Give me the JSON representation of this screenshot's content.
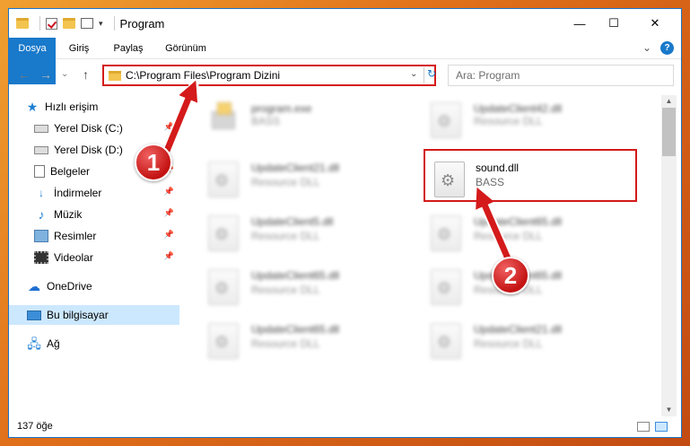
{
  "window": {
    "title": "Program",
    "minimize_glyph": "—",
    "maximize_glyph": "☐",
    "close_glyph": "✕"
  },
  "ribbon": {
    "tabs": [
      {
        "label": "Dosya"
      },
      {
        "label": "Giriş"
      },
      {
        "label": "Paylaş"
      },
      {
        "label": "Görünüm"
      }
    ],
    "collapse_glyph": "⌄",
    "help_glyph": "?"
  },
  "navbar": {
    "back_glyph": "←",
    "forward_glyph": "→",
    "history_glyph": "⌄",
    "up_glyph": "↑",
    "address": "C:\\Program Files\\Program Dizini",
    "dropdown_glyph": "⌄",
    "refresh_glyph": "↻",
    "search_placeholder": "Ara: Program"
  },
  "sidebar": {
    "items": [
      {
        "label": "Hızlı erişim",
        "icon": "star-icon",
        "pinned": false
      },
      {
        "label": "Yerel Disk (C:)",
        "icon": "drive-icon",
        "pinned": true
      },
      {
        "label": "Yerel Disk (D:)",
        "icon": "drive-icon",
        "pinned": true
      },
      {
        "label": "Belgeler",
        "icon": "documents-icon",
        "pinned": true
      },
      {
        "label": "İndirmeler",
        "icon": "downloads-icon",
        "pinned": true
      },
      {
        "label": "Müzik",
        "icon": "music-icon",
        "pinned": true
      },
      {
        "label": "Resimler",
        "icon": "pictures-icon",
        "pinned": true
      },
      {
        "label": "Videolar",
        "icon": "videos-icon",
        "pinned": true
      },
      {
        "label": "OneDrive",
        "icon": "onedrive-icon",
        "pinned": false
      },
      {
        "label": "Bu bilgisayar",
        "icon": "this-pc-icon",
        "pinned": false,
        "selected": true
      },
      {
        "label": "Ağ",
        "icon": "network-icon",
        "pinned": false
      }
    ],
    "pin_glyph": "📌"
  },
  "files": [
    {
      "name": "program.exe",
      "desc": "BASS",
      "type": "exe",
      "blurred": true
    },
    {
      "name": "UpdateClient42.dll",
      "desc": "Resource DLL",
      "type": "dll",
      "blurred": true
    },
    {
      "name": "UpdateClient21.dll",
      "desc": "Resource DLL",
      "type": "dll",
      "blurred": true
    },
    {
      "name": "sound.dll",
      "desc": "BASS",
      "type": "dll",
      "blurred": false,
      "highlighted": true
    },
    {
      "name": "UpdateClient5.dll",
      "desc": "Resource DLL",
      "type": "dll",
      "blurred": true
    },
    {
      "name": "UpdateClient65.dll",
      "desc": "Resource DLL",
      "type": "dll",
      "blurred": true
    },
    {
      "name": "UpdateClient65.dll",
      "desc": "Resource DLL",
      "type": "dll",
      "blurred": true
    },
    {
      "name": "UpdateClient65.dll",
      "desc": "Resource DLL",
      "type": "dll",
      "blurred": true
    },
    {
      "name": "UpdateClient65.dll",
      "desc": "Resource DLL",
      "type": "dll",
      "blurred": true
    },
    {
      "name": "UpdateClient21.dll",
      "desc": "Resource DLL",
      "type": "dll",
      "blurred": true
    }
  ],
  "status": {
    "item_count": "137 öğe"
  },
  "callouts": [
    {
      "number": "1"
    },
    {
      "number": "2"
    }
  ],
  "colors": {
    "accent": "#1979ca",
    "annotation_red": "#d41a1a",
    "selected_bg": "#cce8ff"
  }
}
